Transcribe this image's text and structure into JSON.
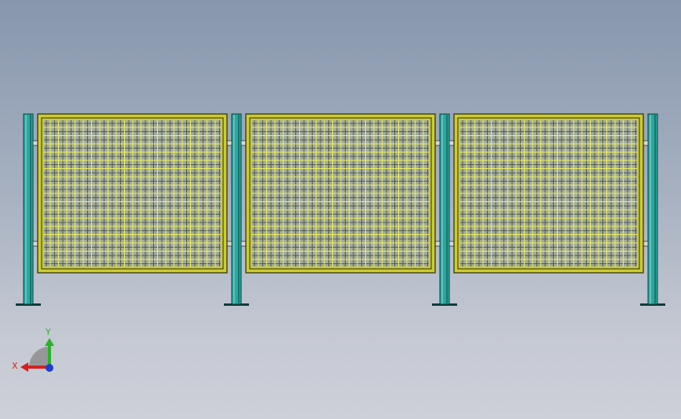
{
  "viewport": {
    "model_name": "",
    "background_top": "#8796ad",
    "background_bottom": "#cdd0d8"
  },
  "model": {
    "post_color": "#2aa7a0",
    "post_dark": "#0f3c3a",
    "frame_color": "#cccc33",
    "frame_edge": "#2a2a10",
    "mesh_yellow": "#eeee55",
    "mesh_dark": "#4d5a52",
    "panel_count": 3,
    "post_count": 4
  },
  "triad": {
    "x_label": "X",
    "y_label": "Y",
    "x_color": "#d42020",
    "y_color": "#2ab32a",
    "z_color": "#1f3fd0"
  }
}
